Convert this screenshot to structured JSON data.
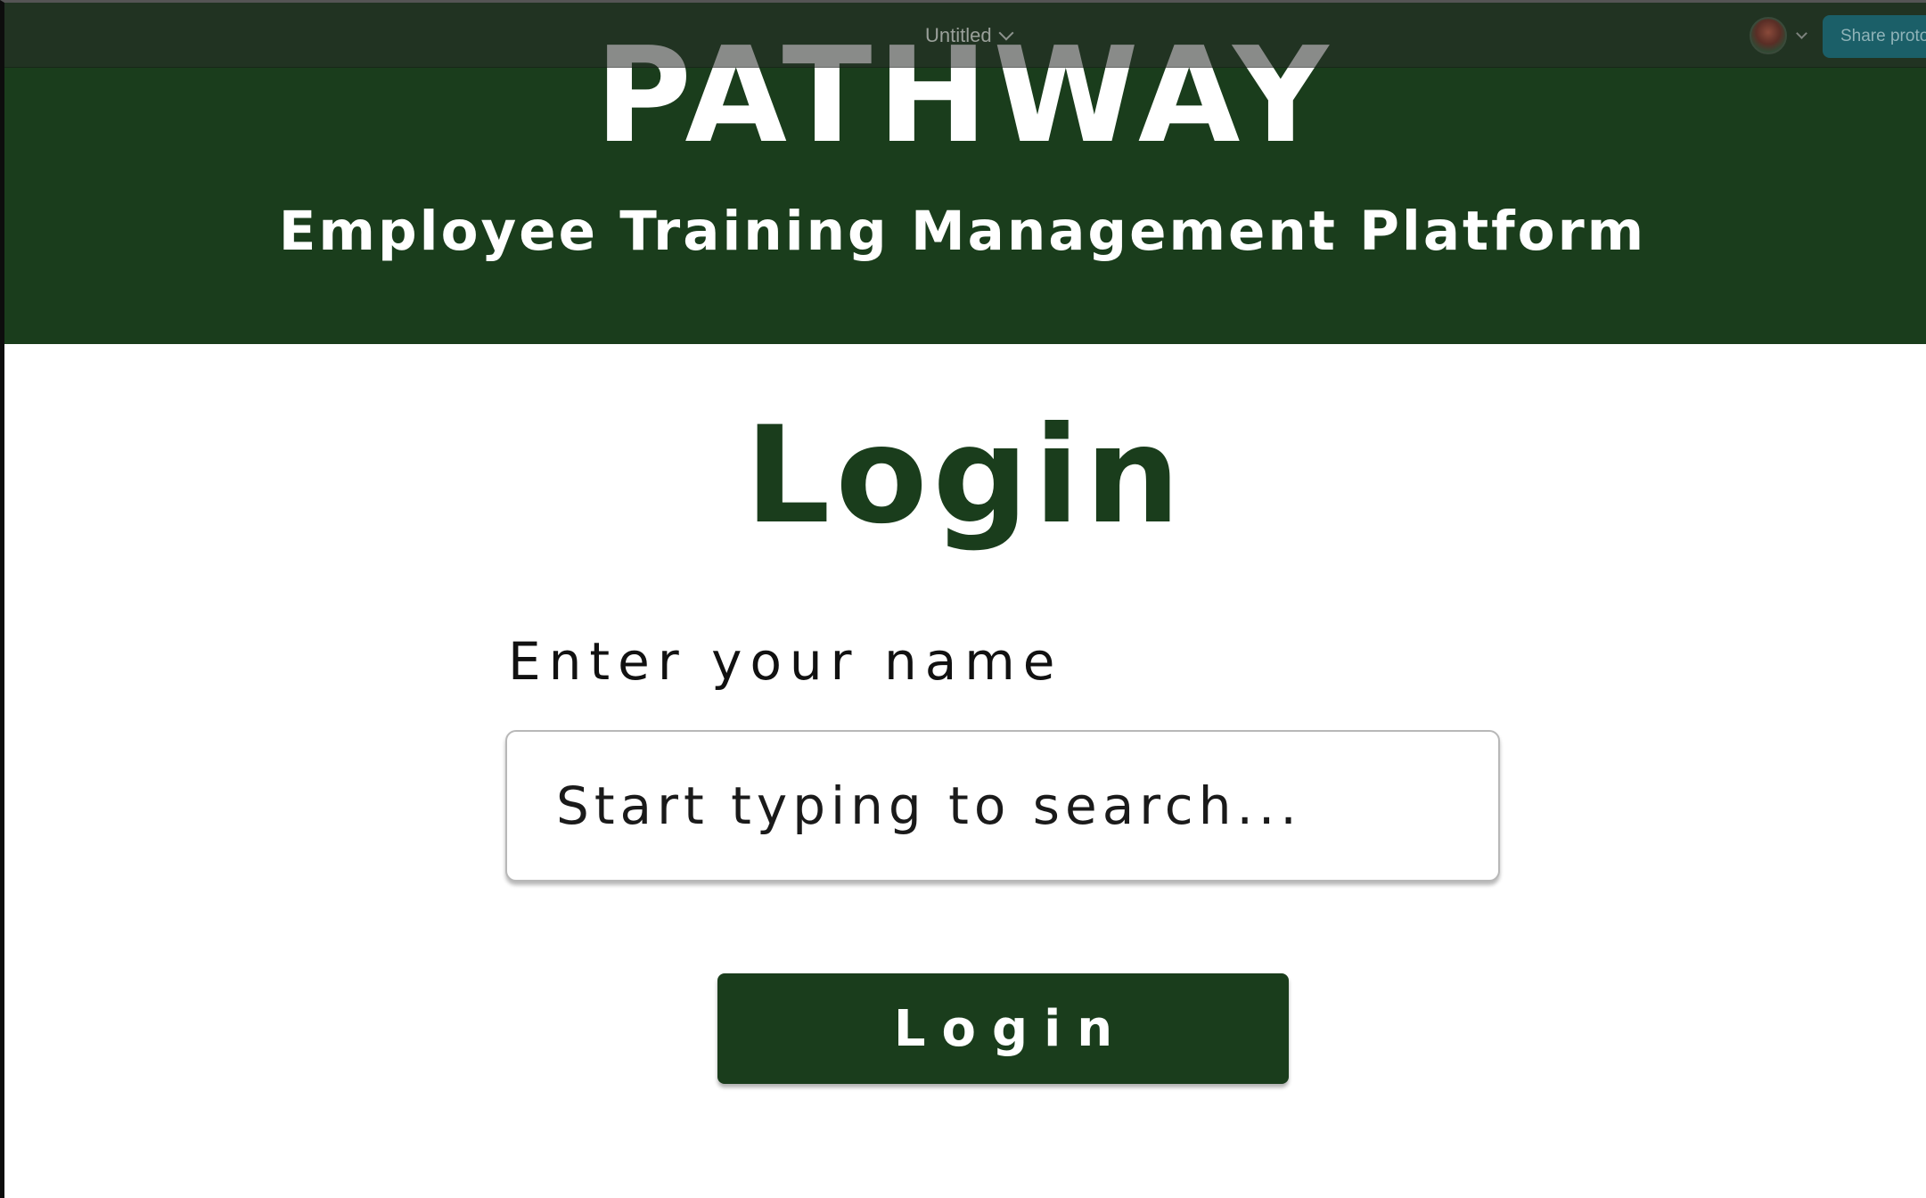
{
  "toolbar": {
    "document_title": "Untitled",
    "share_label": "Share prototype",
    "share_visible_text": "Share protot"
  },
  "hero": {
    "title": "PATHWAY",
    "subtitle": "Employee Training Management Platform",
    "background_color": "#1a3d1c"
  },
  "login": {
    "heading": "Login",
    "name_label": "Enter your name",
    "name_input": {
      "value": "",
      "placeholder": "Start typing to search..."
    },
    "button_label": "Login"
  }
}
